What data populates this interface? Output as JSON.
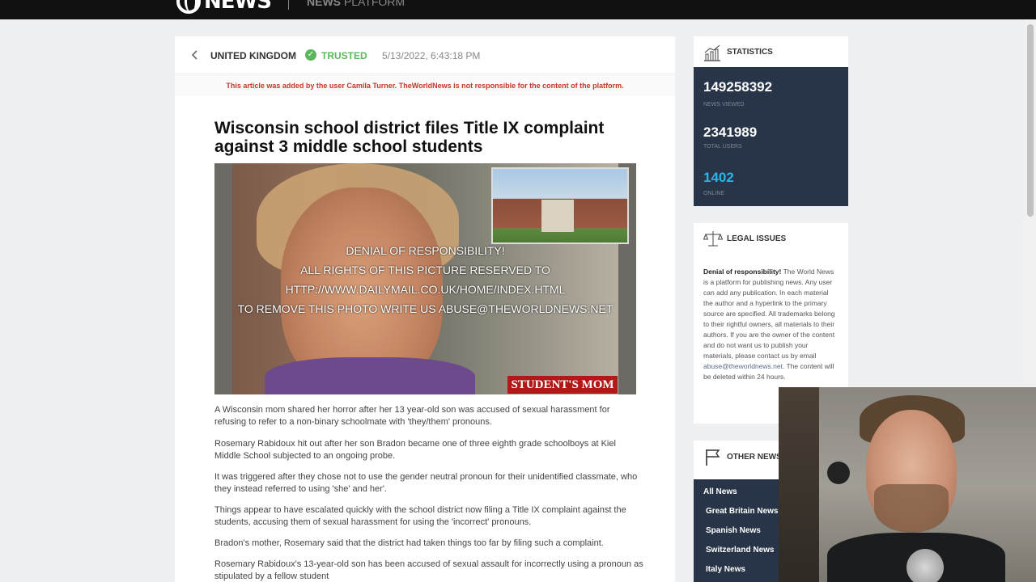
{
  "topbar": {
    "logo_text": "NEWS",
    "platform_bold": "NEWS",
    "platform_rest": " PLATFORM"
  },
  "article": {
    "country": "UNITED KINGDOM",
    "trusted_label": "TRUSTED",
    "date": "5/13/2022, 6:43:18 PM",
    "notice": "This article was added by the user Camila Turner. TheWorldNews is not responsible for the content of the platform.",
    "title": "Wisconsin school district files Title IX complaint against 3 middle school students",
    "photo": {
      "overlay_lines": [
        "DENIAL OF RESPONSIBILITY!",
        "ALL RIGHTS OF THIS PICTURE RESERVED TO",
        "HTTP://WWW.DAILYMAIL.CO.UK/HOME/INDEX.HTML",
        "TO REMOVE THIS PHOTO WRITE US ABUSE@THEWORLDNEWS.NET"
      ],
      "caption_tag": "STUDENT'S MOM"
    },
    "paragraphs": [
      "A Wisconsin mom shared her horror after her 13 year-old son was accused of sexual harassment for refusing to refer to a non-binary schoolmate with 'they/them' pronouns.",
      "Rosemary Rabidoux hit out after her son Bradon became one of three eighth grade schoolboys at Kiel Middle School subjected to an ongoing probe.",
      "It was triggered after they chose not to use the gender neutral pronoun for their unidentified classmate, who they instead referred to using 'she' and her'.",
      "Things appear to have escalated quickly with the school district now filing a Title IX complaint against the students, accusing them of sexual harassment for using the  'incorrect' pronouns.",
      "Bradon's mother, Rosemary said that the district had taken things too far by filing such a complaint.",
      "Rosemary Rabidoux's 13-year-old son has been accused of sexual assault for incorrectly using a pronoun as stipulated by a fellow student"
    ]
  },
  "statistics": {
    "title": "STATISTICS",
    "items": [
      {
        "value": "149258392",
        "label": "NEWS VIEWED"
      },
      {
        "value": "2341989",
        "label": "TOTAL USERS"
      },
      {
        "value": "1402",
        "label": "ONLINE"
      }
    ]
  },
  "legal": {
    "title": "LEGAL ISSUES",
    "lead": "Denial of responsibility!",
    "text": " The World News is a platform for publishing news. Any user can add any publication. In each material the author and a hyperlink to the primary source are specified. All trademarks belong to their rightful owners, all materials to their authors. If you are the owner of the content and do not want us to publish your materials, please contact us by email ",
    "email": "abuse@theworldnews.net",
    "tail": ". The content will be deleted within 24 hours."
  },
  "other_news": {
    "title": "OTHER NEWS",
    "items": [
      "All News",
      "Great Britain News",
      "Spanish News",
      "Switzerland News",
      "Italy News"
    ]
  },
  "colors": {
    "trusted": "#5cb85c",
    "notice": "#c0392b",
    "sidebar_dark": "#283447",
    "online": "#29b6e8"
  }
}
